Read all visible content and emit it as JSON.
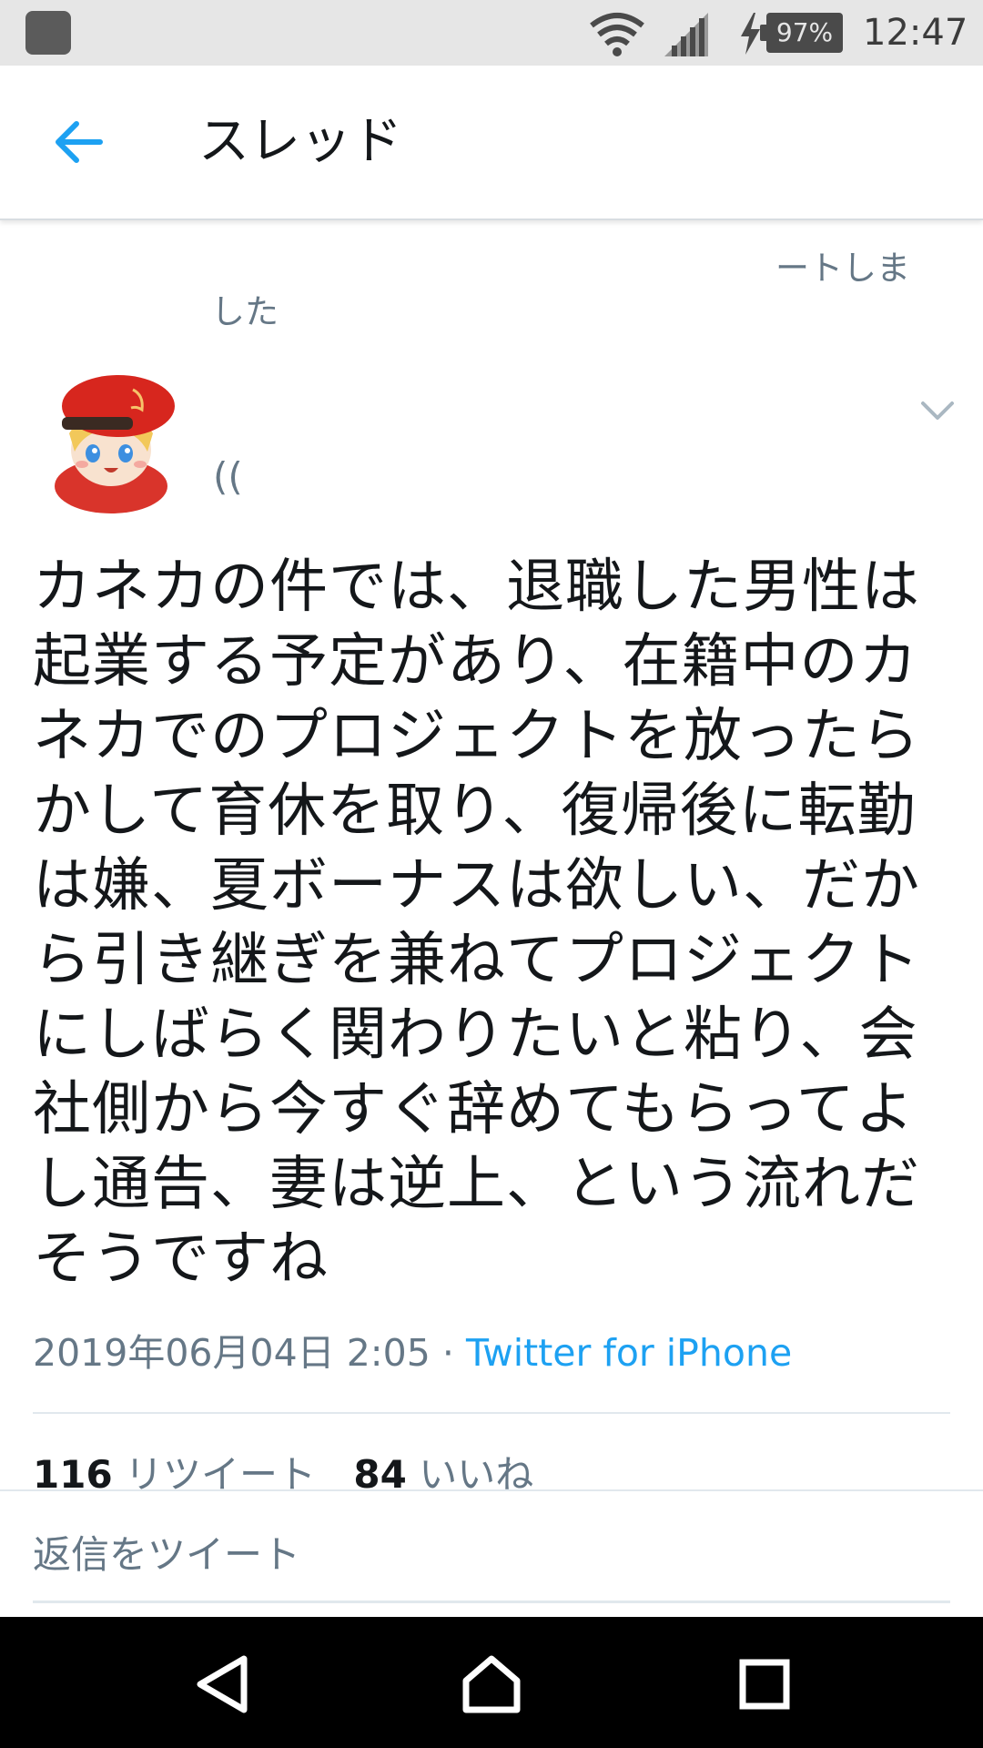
{
  "status_bar": {
    "battery_percent": "97%",
    "time": "12:47",
    "icons": [
      "app-notification-icon",
      "wifi-icon",
      "signal-icon",
      "charging-bolt-icon",
      "battery-icon"
    ]
  },
  "header": {
    "back_icon": "back-arrow-icon",
    "title": "スレッド"
  },
  "social_context": {
    "line1": "ートしま",
    "line2": "した"
  },
  "author": {
    "handle_fragment": "(("
  },
  "tweet": {
    "text": "カネカの件では、退職した男性は起業する予定があり、在籍中のカネカでのプロジェクトを放ったらかして育休を取り、復帰後に転勤は嫌、夏ボーナスは欲しい、だから引き継ぎを兼ねてプロジェクトにしばらく関わりたいと粘り、会社側から今すぐ辞めてもらってよし通告、妻は逆上、という流れだそうですね",
    "date": "2019年06月04日 2:05",
    "separator": "·",
    "source": "Twitter for iPhone",
    "retweets": "116",
    "retweets_label": "リツイート",
    "likes": "84",
    "likes_label": "いいね"
  },
  "reply": {
    "placeholder": "返信をツイート"
  },
  "nav_bar": {
    "buttons": [
      "back-triangle-icon",
      "home-icon",
      "recent-apps-icon"
    ]
  },
  "colors": {
    "accent": "#1da1f2",
    "text_primary": "#14171a",
    "text_secondary": "#657786",
    "status_bar_bg": "#e6e6e6",
    "nav_bar_bg": "#000000"
  }
}
